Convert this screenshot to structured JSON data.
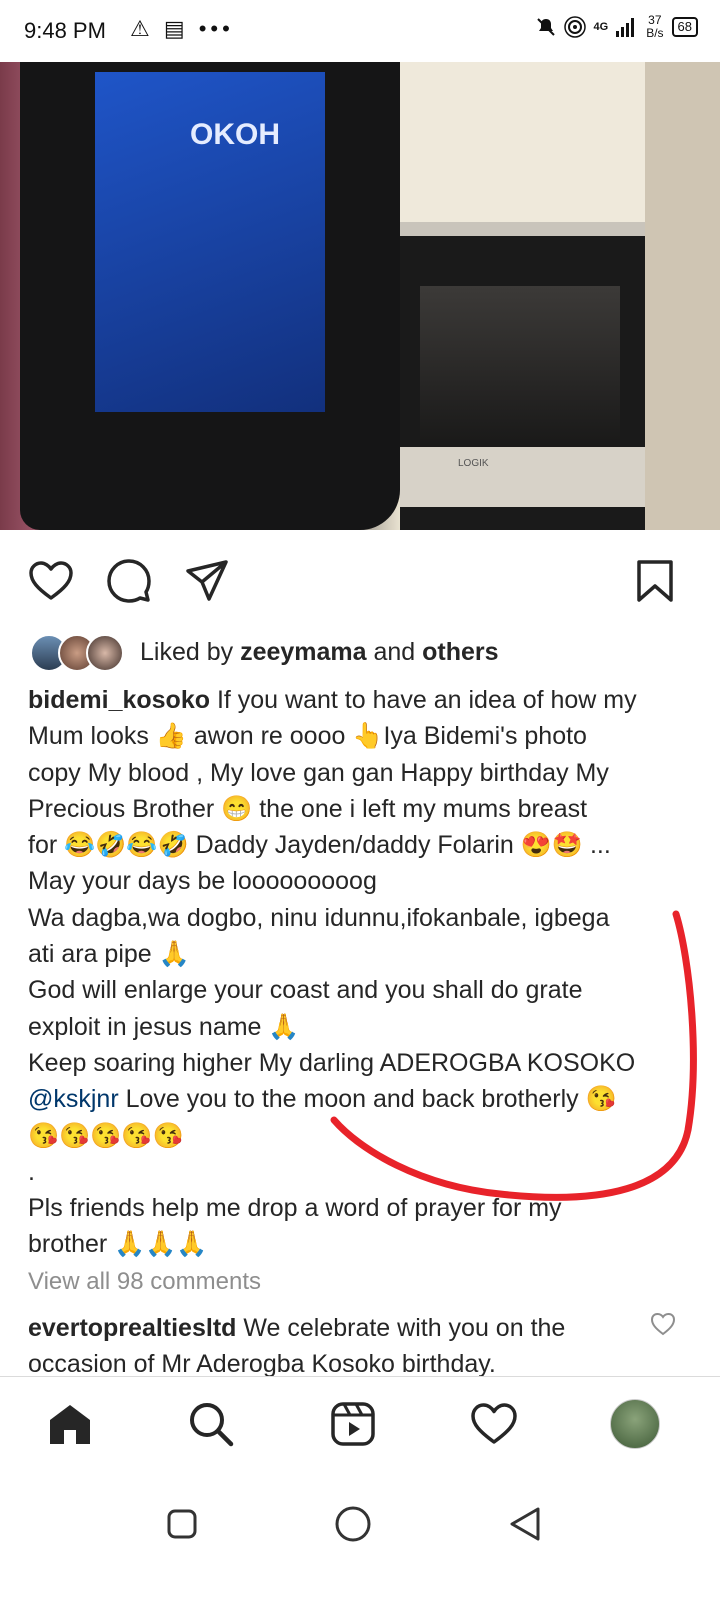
{
  "status_bar": {
    "time": "9:48 PM",
    "left_icons": "⚠ ▤ •••",
    "network": "4G",
    "speed_value": "37",
    "speed_unit": "B/s",
    "battery": "68"
  },
  "photo": {
    "shirt_text": "OKOH",
    "oven_brand": "LOGIK"
  },
  "actions": {
    "icons": [
      "heart-outline-icon",
      "comment-icon",
      "share-icon",
      "bookmark-icon"
    ]
  },
  "likes": {
    "prefix": "Liked by ",
    "user": "zeeymama",
    "middle": " and ",
    "others": "others"
  },
  "caption": {
    "username": "bidemi_kosoko",
    "lines": [
      " If you want to have an idea of how my",
      "Mum looks 👍 awon re oooo 👆Iya Bidemi's photo",
      "copy  My blood , My love gan gan Happy birthday My",
      "Precious Brother 😁 the one i left my mums breast",
      "for 😂🤣😂🤣 Daddy Jayden/daddy Folarin 😍🤩 ...",
      "May your days be looooooooog",
      "Wa dagba,wa dogbo, ninu idunnu,ifokanbale, igbega",
      "ati ara pipe 🙏",
      "God will enlarge your coast and you shall do grate",
      "exploit in jesus name 🙏",
      "Keep soaring higher My darling ADEROGBA KOSOKO"
    ],
    "mention": "@kskjnr",
    "after_mention": " Love you to the moon and back brotherly 😘",
    "kisses": "😘😘😘😘😘",
    "dot": ".",
    "line_pls": "Pls friends help me drop a word of prayer for my",
    "line_brother": "brother 🙏🙏🙏"
  },
  "view_all_comments": "View all 98 comments",
  "comment": {
    "username": "evertoprealtiesltd",
    "text": " We celebrate with you on the occasion of Mr Aderogba Kosoko birthday."
  },
  "annotation_color": "#e8232a",
  "bottom_nav": {
    "items": [
      "home-icon",
      "search-icon",
      "reels-icon",
      "activity-heart-icon",
      "profile-avatar"
    ]
  },
  "system_nav": {
    "items": [
      "recents-square-icon",
      "home-circle-icon",
      "back-triangle-icon"
    ]
  }
}
